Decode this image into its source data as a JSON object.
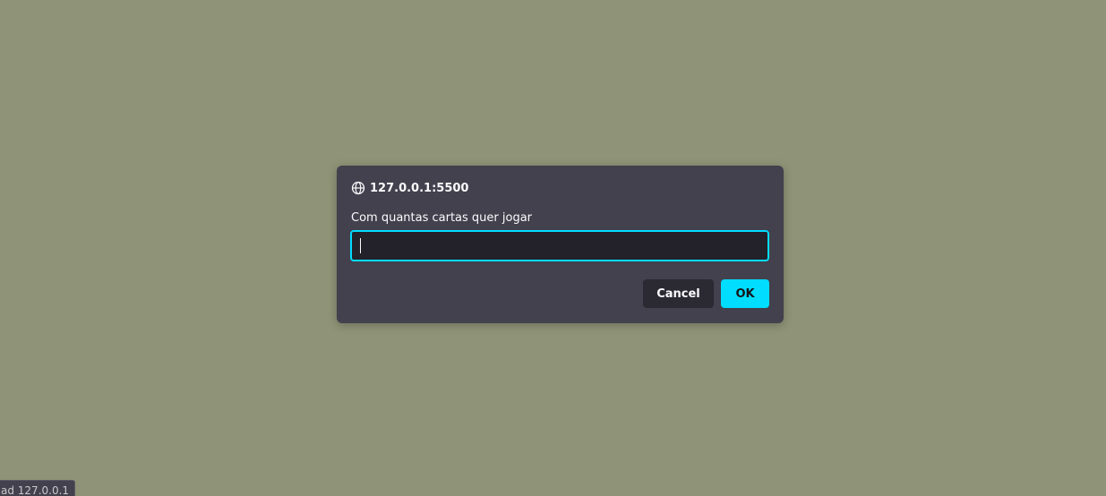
{
  "dialog": {
    "origin": "127.0.0.1:5500",
    "origin_icon": "globe-icon",
    "message": "Com quantas cartas quer jogar",
    "input_value": "",
    "cancel_label": "Cancel",
    "ok_label": "OK"
  },
  "status_bar": {
    "text": "ad 127.0.0.1"
  },
  "colors": {
    "page_background": "#8f9377",
    "dialog_background": "#42414d",
    "accent": "#00ddff",
    "input_background": "#23222b"
  }
}
